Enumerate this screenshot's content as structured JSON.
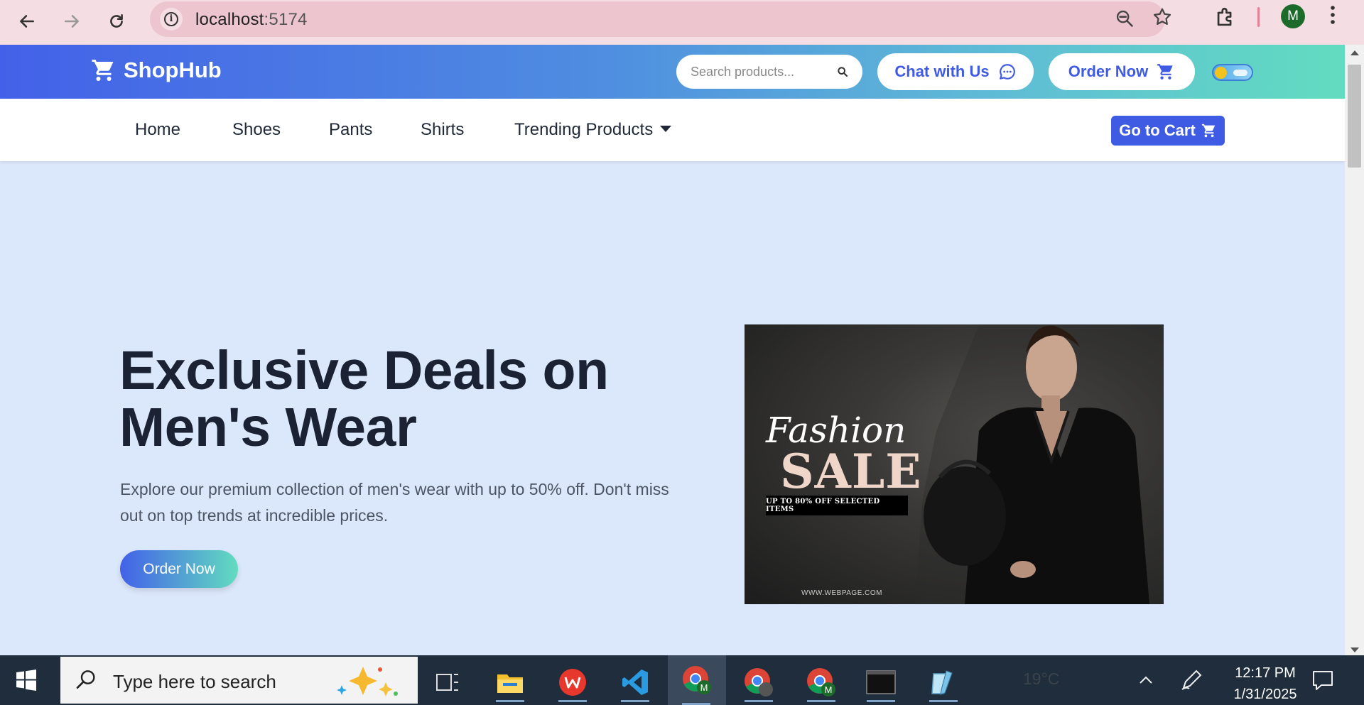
{
  "browser": {
    "url_host": "localhost",
    "url_port": ":5174",
    "profile_initial": "M",
    "icons": [
      "back-icon",
      "forward-icon",
      "reload-icon",
      "site-info-icon",
      "zoom-icon",
      "bookmark-star-icon",
      "extensions-icon",
      "menu-icon"
    ]
  },
  "header": {
    "brand": "ShopHub",
    "search_placeholder": "Search products...",
    "chat_label": "Chat with Us",
    "order_label": "Order Now",
    "theme_toggle": "light"
  },
  "nav": {
    "items": [
      "Home",
      "Shoes",
      "Pants",
      "Shirts",
      "Trending Products"
    ],
    "cart_label": "Go to Cart"
  },
  "hero": {
    "title_line1": "Exclusive Deals on",
    "title_line2": "Men's Wear",
    "description": "Explore our premium collection of men's wear with up to 50% off. Don't miss out on top trends at incredible prices.",
    "cta": "Order Now",
    "promo": {
      "script_text": "Fashion",
      "sale_text": "SALE",
      "offer_text": "UP TO 80% OFF SELECTED ITEMS",
      "website": "WWW.WEBPAGE.COM"
    }
  },
  "taskbar": {
    "search_placeholder": "Type here to search",
    "weather": "19°C",
    "time": "12:17 PM",
    "date": "1/31/2025"
  },
  "colors": {
    "accent": "#3f5be3",
    "gradient_start": "#4361e8",
    "gradient_end": "#62dcc0",
    "hero_bg": "#dbe7fb",
    "heading": "#1a2233"
  }
}
